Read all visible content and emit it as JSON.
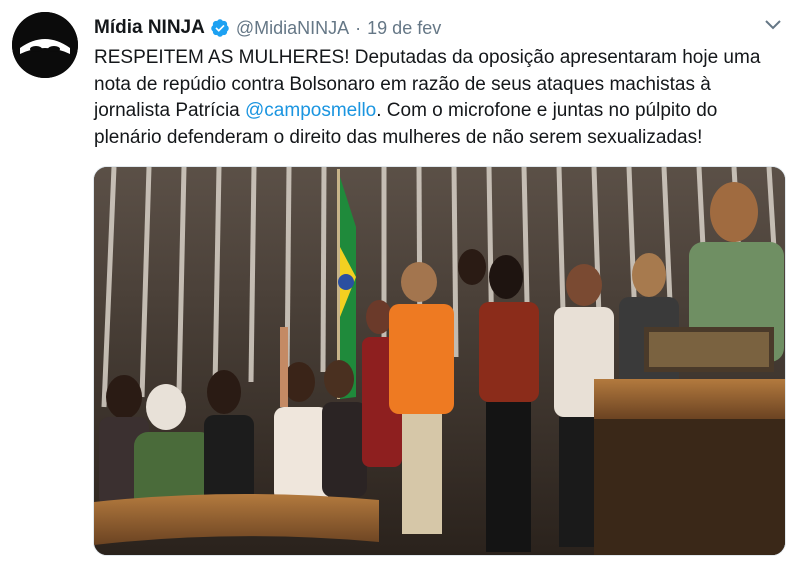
{
  "account": {
    "display_name": "Mídia NINJA",
    "handle": "@MidiaNINJA",
    "separator": "·",
    "date": "19 de fev",
    "verified": true,
    "avatar_icon": "ninja-mask-icon"
  },
  "tweet": {
    "text_before_mention": "RESPEITEM AS MULHERES! Deputadas da oposição apresentaram hoje uma nota de repúdio contra Bolsonaro em razão de seus ataques machistas à jornalista Patrícia ",
    "mention": "@camposmello",
    "text_after_mention": ". Com o microfone e juntas no púlpito do plenário defenderam o direito das mulheres de não serem sexualizadas!"
  },
  "media": {
    "icon": "photo-plenary-women-deputies",
    "description_colors": {
      "wall": "#2b2520",
      "flag_green": "#1f8a3b",
      "flag_yellow": "#f2d021",
      "desk": "#9b6a35"
    }
  },
  "colors": {
    "text": "#14171a",
    "muted": "#657786",
    "link": "#1b95e0",
    "verified": "#1da1f2"
  }
}
